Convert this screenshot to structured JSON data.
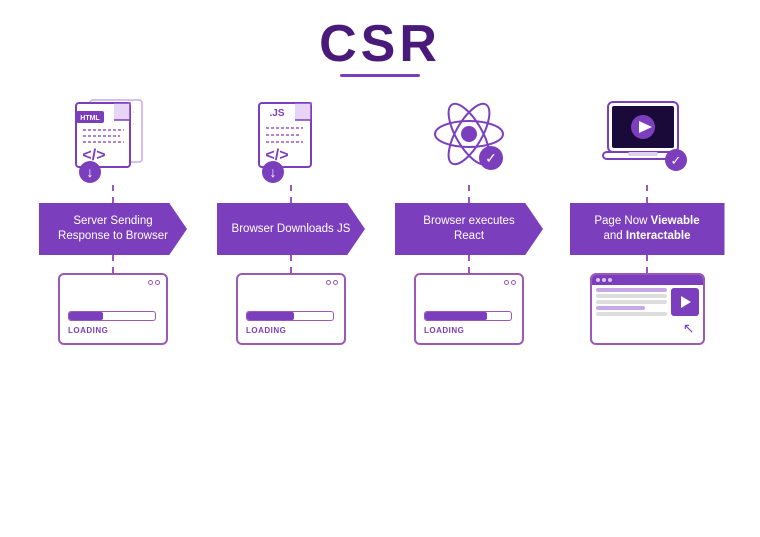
{
  "title": "CSR",
  "steps": [
    {
      "id": "server-response",
      "icon_type": "html-doc",
      "badge_text": "Server Sending Response to Browser",
      "badge_bold": "",
      "bottom_type": "loading",
      "loading_width": 40,
      "loading_label": "LOADING"
    },
    {
      "id": "browser-downloads",
      "icon_type": "js-doc",
      "badge_text": "Browser Downloads JS",
      "badge_bold": "",
      "bottom_type": "loading",
      "loading_width": 55,
      "loading_label": "LOADING"
    },
    {
      "id": "browser-react",
      "icon_type": "react",
      "badge_text": "Browser executes React",
      "badge_bold": "",
      "bottom_type": "loading",
      "loading_width": 70,
      "loading_label": "LOADING"
    },
    {
      "id": "page-viewable",
      "icon_type": "laptop",
      "badge_text_prefix": "Page Now ",
      "badge_bold1": "Viewable",
      "badge_text_mid": " and ",
      "badge_bold2": "Interactable",
      "bottom_type": "website",
      "loading_width": 100,
      "loading_label": ""
    }
  ]
}
